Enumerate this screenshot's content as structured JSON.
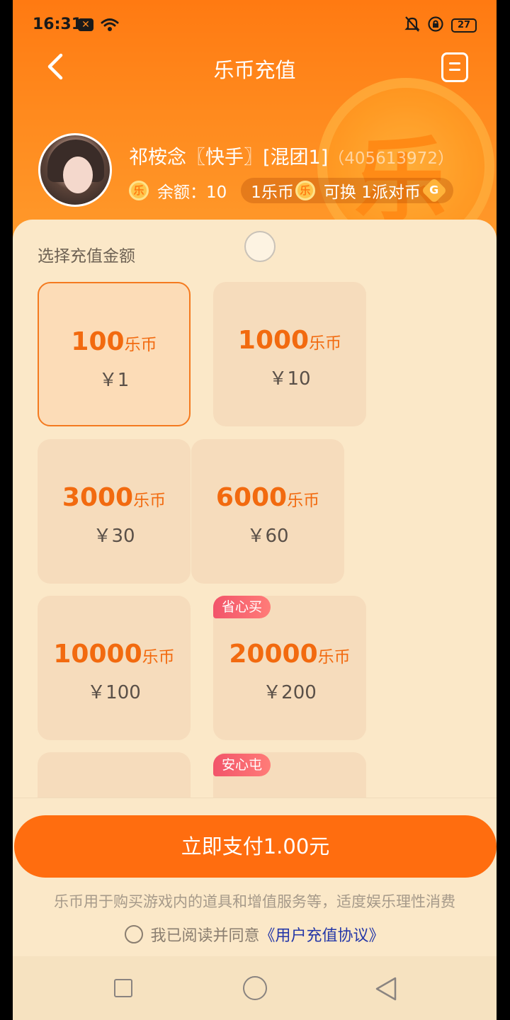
{
  "status_bar": {
    "time": "16:31",
    "notification_icon": "x-box-icon",
    "battery": "27"
  },
  "nav": {
    "title": "乐币充值",
    "back_icon": "chevron-left-icon",
    "menu_icon": "document-icon"
  },
  "profile": {
    "name": "祁桉念〖快手〗[混团1]",
    "uid": "（405613972）",
    "balance_label": "余额：10",
    "exchange_text_1": "1乐币",
    "exchange_text_2": "可换 1派对币",
    "coin_glyph": "乐",
    "party_coin_glyph": "G"
  },
  "recharge": {
    "section_label": "选择充值金额",
    "unit": "乐币",
    "options": [
      {
        "amount": "100",
        "price": "￥1",
        "selected": true,
        "tag": ""
      },
      {
        "amount": "1000",
        "price": "￥10",
        "selected": false,
        "tag": ""
      },
      {
        "amount": "3000",
        "price": "￥30",
        "selected": false,
        "tag": ""
      },
      {
        "amount": "6000",
        "price": "￥60",
        "selected": false,
        "tag": ""
      },
      {
        "amount": "10000",
        "price": "￥100",
        "selected": false,
        "tag": ""
      },
      {
        "amount": "20000",
        "price": "￥200",
        "selected": false,
        "tag": "省心买"
      },
      {
        "amount": "",
        "price": "",
        "selected": false,
        "tag": ""
      },
      {
        "amount": "",
        "price": "",
        "selected": false,
        "tag": "安心屯"
      }
    ]
  },
  "footer": {
    "pay_button": "立即支付1.00元",
    "notice": "乐币用于购买游戏内的道具和增值服务等，适度娱乐理性消费",
    "agree_text": "我已阅读并同意",
    "agree_link": "《用户充值协议》"
  },
  "colors": {
    "accent": "#ff6d0f",
    "header": "#ff7a12",
    "panel": "#fbe8c8",
    "tag": "#f2546a"
  }
}
